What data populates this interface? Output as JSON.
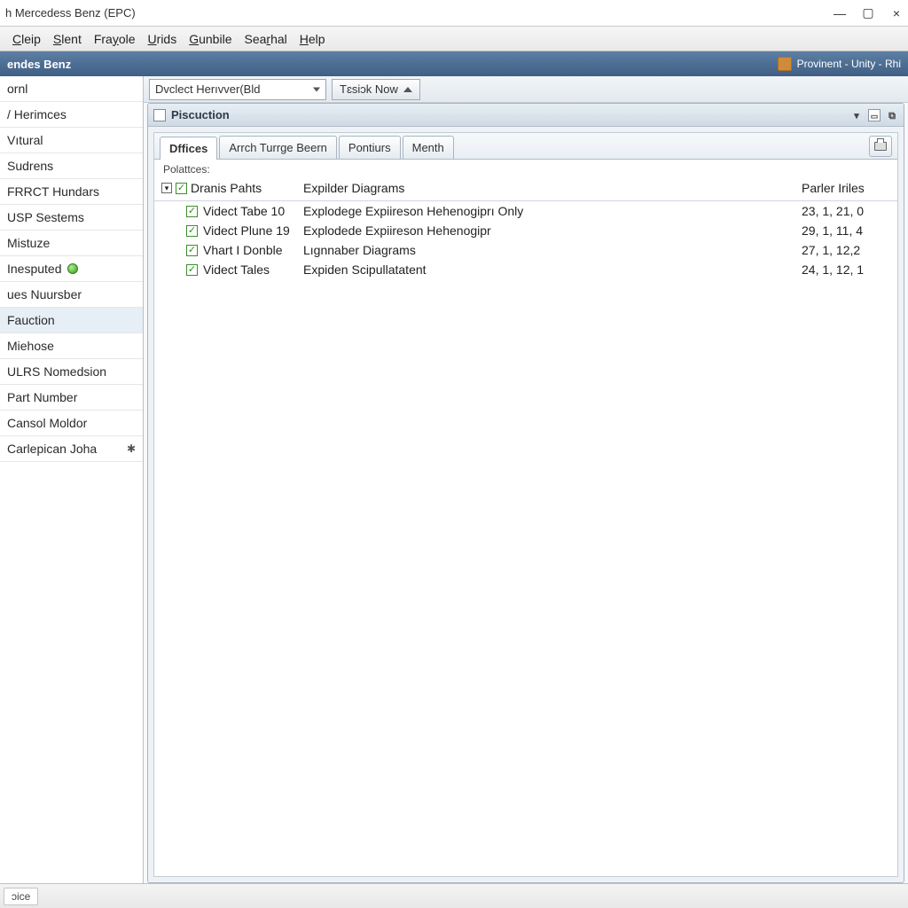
{
  "window": {
    "title": "h Mercedess Benz (EPC)"
  },
  "menu": {
    "items": [
      {
        "pre": "",
        "u": "C",
        "post": "leip"
      },
      {
        "pre": "",
        "u": "S",
        "post": "lent"
      },
      {
        "pre": "Fra",
        "u": "y",
        "post": "ole"
      },
      {
        "pre": "",
        "u": "U",
        "post": "rids"
      },
      {
        "pre": "",
        "u": "G",
        "post": "unbile"
      },
      {
        "pre": "Sea",
        "u": "r",
        "post": "hal"
      },
      {
        "pre": "",
        "u": "H",
        "post": "elp"
      }
    ]
  },
  "header_strip": {
    "left": "endes Benz",
    "right": "Provinent - Unity - Rhi"
  },
  "toolbar": {
    "dropdown_selected": "Dvclect Herıvver(Bld",
    "task_label": "Tɛsiɔk Now"
  },
  "panel": {
    "title": "Piscuction"
  },
  "tabs": {
    "items": [
      "Dffices",
      "Arrch Turrge Beern",
      "Pontiurs",
      "Menth"
    ],
    "active": 0
  },
  "table": {
    "subtitle": "Polattces:",
    "col_tree": "Dranis Pahts",
    "col_desc": "Expilder Diagrams",
    "col_num": "Parler  Iriles",
    "rows": [
      {
        "tree": "Videct Tabe 10",
        "desc": "Explodege Expiireson Hehenogiprı Only",
        "num": "23, 1, 21, 0"
      },
      {
        "tree": "Videct Plune 19",
        "desc": "Explodede Expiireson Hehenogipr",
        "num": "29, 1, 11, 4"
      },
      {
        "tree": "Vhart I Donble",
        "desc": "Lıgnnaber Diagrams",
        "num": "27, 1, 12,2"
      },
      {
        "tree": "Videct Tales",
        "desc": "Expiden Scipullatatent",
        "num": "24, 1, 12, 1"
      }
    ]
  },
  "sidebar": {
    "items": [
      {
        "label": "ornl",
        "kind": "plain"
      },
      {
        "label": "/ Herimces",
        "kind": "plain"
      },
      {
        "label": "Vıtural",
        "kind": "plain"
      },
      {
        "label": "Sudrens",
        "kind": "plain"
      },
      {
        "label": "FRRCT Hundars",
        "kind": "plain"
      },
      {
        "label": "USP Sestems",
        "kind": "plain"
      },
      {
        "label": "Mistuze",
        "kind": "plain"
      },
      {
        "label": "Inesputed",
        "kind": "dot"
      },
      {
        "label": "ues Nuursber",
        "kind": "plain"
      },
      {
        "label": "Fauction",
        "kind": "selected"
      },
      {
        "label": "Miehose",
        "kind": "plain"
      },
      {
        "label": "ULRS Nomedsion",
        "kind": "plain"
      },
      {
        "label": "Part Number",
        "kind": "plain"
      },
      {
        "label": "Cansol Moldor",
        "kind": "plain"
      },
      {
        "label": "Carlepican Joha",
        "kind": "gear"
      }
    ]
  },
  "status": {
    "seg": "ɔice"
  }
}
